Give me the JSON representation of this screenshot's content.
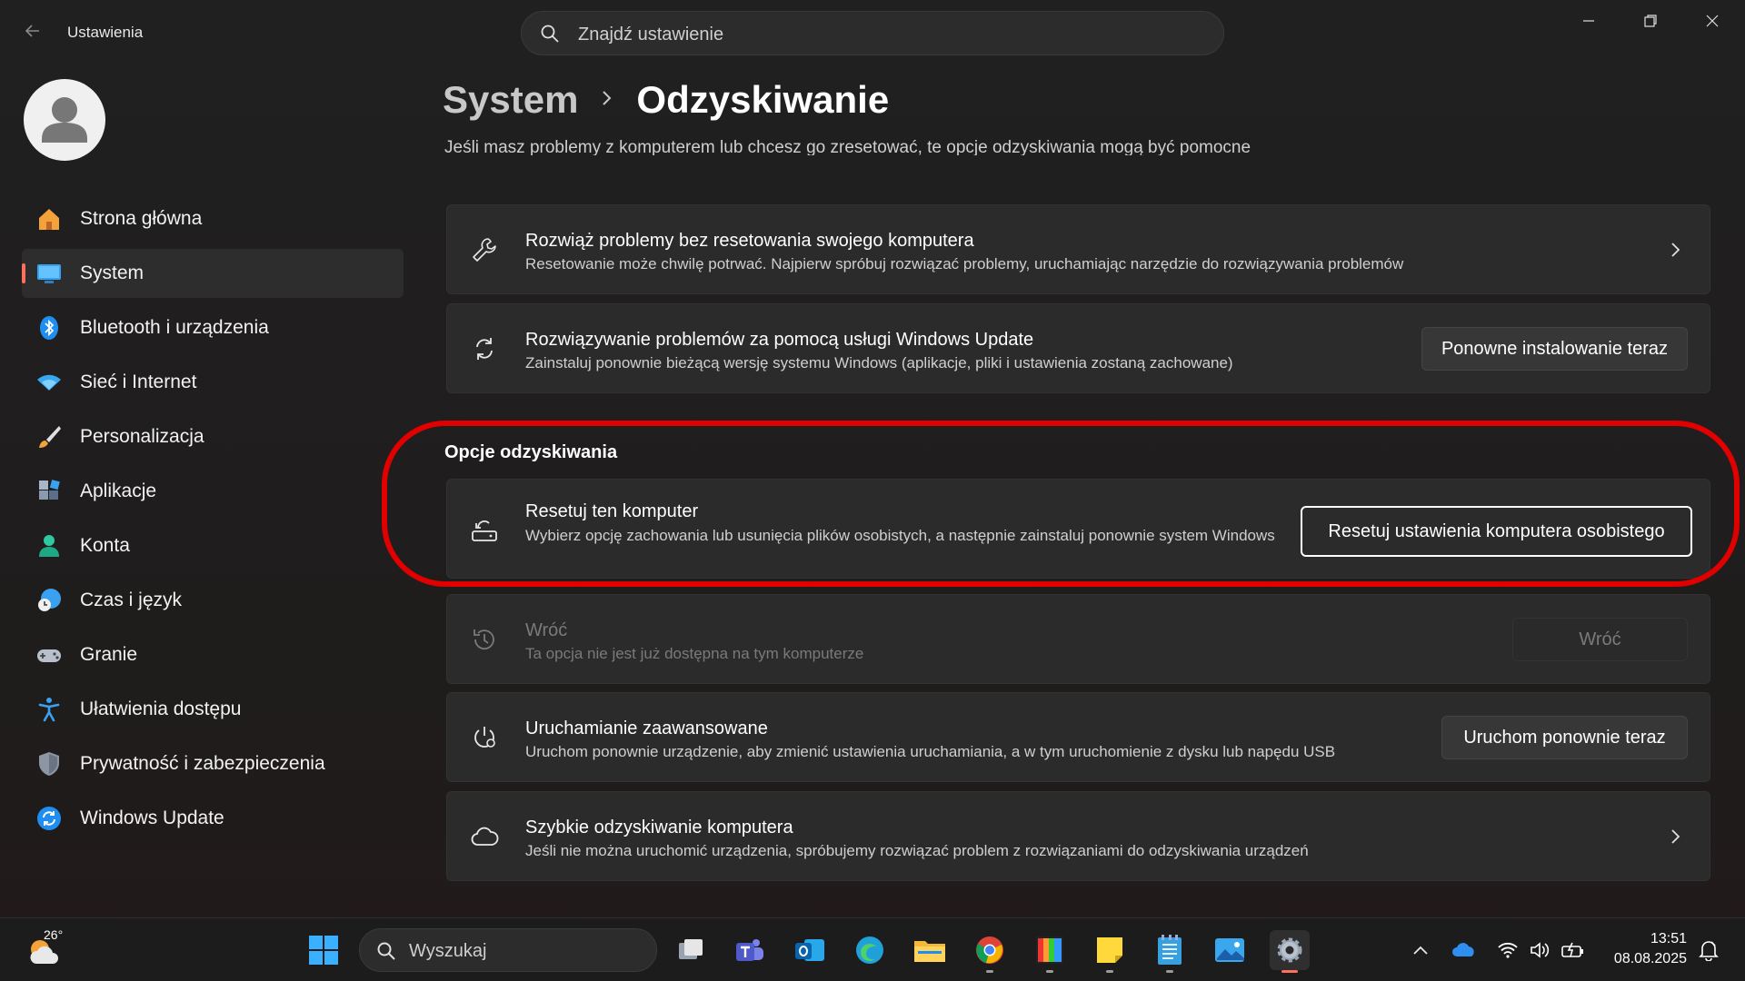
{
  "window": {
    "app_title": "Ustawienia",
    "search_placeholder": "Znajdź ustawienie"
  },
  "sidebar": {
    "items": [
      {
        "label": "Strona główna",
        "icon": "home-icon"
      },
      {
        "label": "System",
        "icon": "system-display-icon",
        "active": true
      },
      {
        "label": "Bluetooth i urządzenia",
        "icon": "bluetooth-icon"
      },
      {
        "label": "Sieć i Internet",
        "icon": "wifi-icon"
      },
      {
        "label": "Personalizacja",
        "icon": "brush-icon"
      },
      {
        "label": "Aplikacje",
        "icon": "apps-icon"
      },
      {
        "label": "Konta",
        "icon": "account-icon"
      },
      {
        "label": "Czas i język",
        "icon": "time-language-icon"
      },
      {
        "label": "Granie",
        "icon": "gamepad-icon"
      },
      {
        "label": "Ułatwienia dostępu",
        "icon": "accessibility-icon"
      },
      {
        "label": "Prywatność i zabezpieczenia",
        "icon": "shield-icon"
      },
      {
        "label": "Windows Update",
        "icon": "windows-update-icon"
      }
    ]
  },
  "header": {
    "breadcrumb_parent": "System",
    "breadcrumb_current": "Odzyskiwanie",
    "subtitle": "Jeśli masz problemy z komputerem lub chcesz go zresetować, te opcje odzyskiwania mogą być pomocne"
  },
  "cards": {
    "troubleshoot": {
      "title": "Rozwiąż problemy bez resetowania swojego komputera",
      "desc": "Resetowanie może chwilę potrwać. Najpierw spróbuj rozwiązać problemy, uruchamiając narzędzie do rozwiązywania problemów"
    },
    "windows_update_fix": {
      "title": "Rozwiązywanie problemów za pomocą usługi Windows Update",
      "desc": "Zainstaluj ponownie bieżącą wersję systemu Windows (aplikacje, pliki i ustawienia zostaną zachowane)",
      "button": "Ponowne instalowanie teraz"
    }
  },
  "recovery_options": {
    "section_title": "Opcje odzyskiwania",
    "reset": {
      "title": "Resetuj ten komputer",
      "desc": "Wybierz opcję zachowania lub usunięcia plików osobistych, a następnie zainstaluj ponownie system Windows",
      "button": "Resetuj ustawienia komputera osobistego"
    },
    "go_back": {
      "title": "Wróć",
      "desc": "Ta opcja nie jest już dostępna na tym komputerze",
      "button": "Wróć"
    },
    "advanced_startup": {
      "title": "Uruchamianie zaawansowane",
      "desc": "Uruchom ponownie urządzenie, aby zmienić ustawienia uruchamiania, a w tym uruchomienie z dysku lub napędu USB",
      "button": "Uruchom ponownie teraz"
    },
    "quick_recovery": {
      "title": "Szybkie odzyskiwanie komputera",
      "desc": "Jeśli nie można uruchomić urządzenia, spróbujemy rozwiązać problem z rozwiązaniami do odzyskiwania urządzeń"
    }
  },
  "taskbar": {
    "weather_temp": "26°",
    "search_placeholder": "Wyszukaj",
    "time": "13:51",
    "date": "08.08.2025"
  },
  "colors": {
    "accent": "#ff6f5e",
    "highlight_ring": "#e00000"
  }
}
